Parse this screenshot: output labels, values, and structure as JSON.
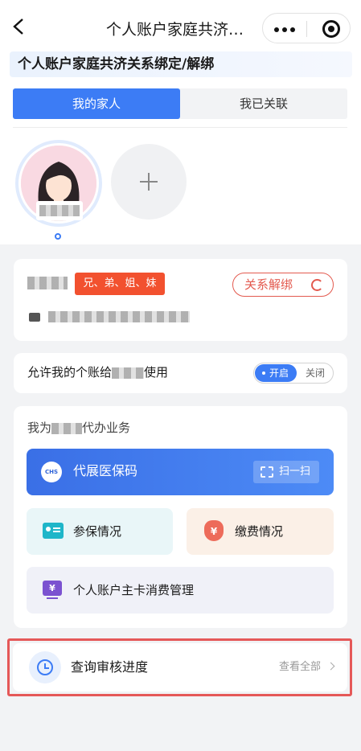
{
  "nav": {
    "title": "个人账户家庭共济…",
    "back_icon": "chevron-left-icon",
    "more_icon": "more-dots-icon",
    "target_icon": "target-icon"
  },
  "page_heading": "个人账户家庭共济关系绑定/解绑",
  "tabs": [
    {
      "label": "我的家人",
      "active": true
    },
    {
      "label": "我已关联",
      "active": false
    }
  ],
  "members": {
    "add_icon": "plus-icon"
  },
  "relation_card": {
    "relation_tag": "兄、弟、姐、妹",
    "unbind_label": "关系解绑",
    "unbind_icon": "unlink-icon",
    "id_icon": "id-card-icon"
  },
  "permission": {
    "prefix": "允许我的个账给",
    "suffix": "使用",
    "toggle_on": "开启",
    "toggle_off": "关闭",
    "enabled": true
  },
  "services": {
    "title_prefix": "我为",
    "title_suffix": "代办业务",
    "qr_label": "代展医保码",
    "scan_label": "扫一扫",
    "logo_text": "CHS",
    "pay_icon_text": "¥",
    "card_icon_text": "¥",
    "tiles": [
      {
        "label": "参保情况"
      },
      {
        "label": "缴费情况"
      },
      {
        "label": "个人账户主卡消费管理"
      }
    ]
  },
  "progress": {
    "label": "查询审核进度",
    "view_all": "查看全部",
    "icon": "clock-icon"
  },
  "colors": {
    "accent": "#3c7cf5",
    "relation_tag": "#f2512f",
    "unbind": "#e35a4f",
    "highlight_frame": "#e55858"
  }
}
